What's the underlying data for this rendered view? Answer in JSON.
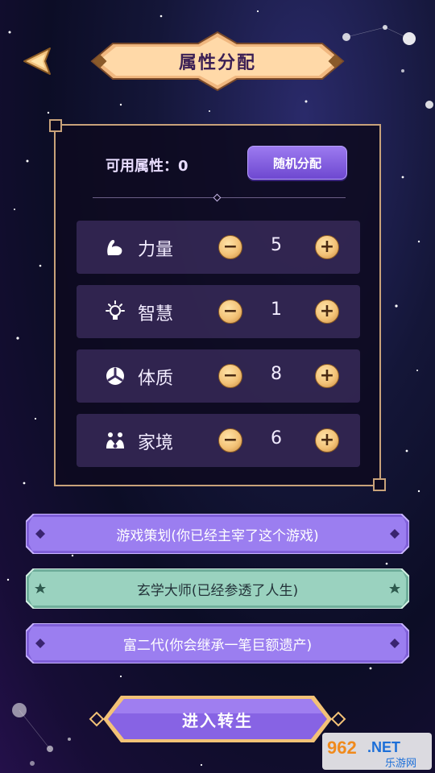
{
  "header": {
    "title": "属性分配"
  },
  "panel": {
    "available_label": "可用属性：0",
    "random_button_label": "随机分配",
    "attributes": [
      {
        "name": "力量",
        "value": "5",
        "icon": "muscle-icon"
      },
      {
        "name": "智慧",
        "value": "1",
        "icon": "lightbulb-icon"
      },
      {
        "name": "体质",
        "value": "8",
        "icon": "constitution-icon"
      },
      {
        "name": "家境",
        "value": "6",
        "icon": "family-icon"
      }
    ],
    "minus_symbol": "−",
    "plus_symbol": "+"
  },
  "talents": [
    {
      "label": "游戏策划(你已经主宰了这个游戏)",
      "style": "purple"
    },
    {
      "label": "玄学大师(已经参透了人生)",
      "style": "teal"
    },
    {
      "label": "富二代(你会继承一笔巨额遗产)",
      "style": "purple"
    }
  ],
  "enter_button": {
    "label": "进入转生"
  },
  "watermark": {
    "brand": "962.NET",
    "sub": "乐游网"
  },
  "colors": {
    "gold": "#f3c277",
    "purple_button": "#8a66e6",
    "teal_banner": "#8fcab6",
    "panel_border": "#c8a27a"
  }
}
